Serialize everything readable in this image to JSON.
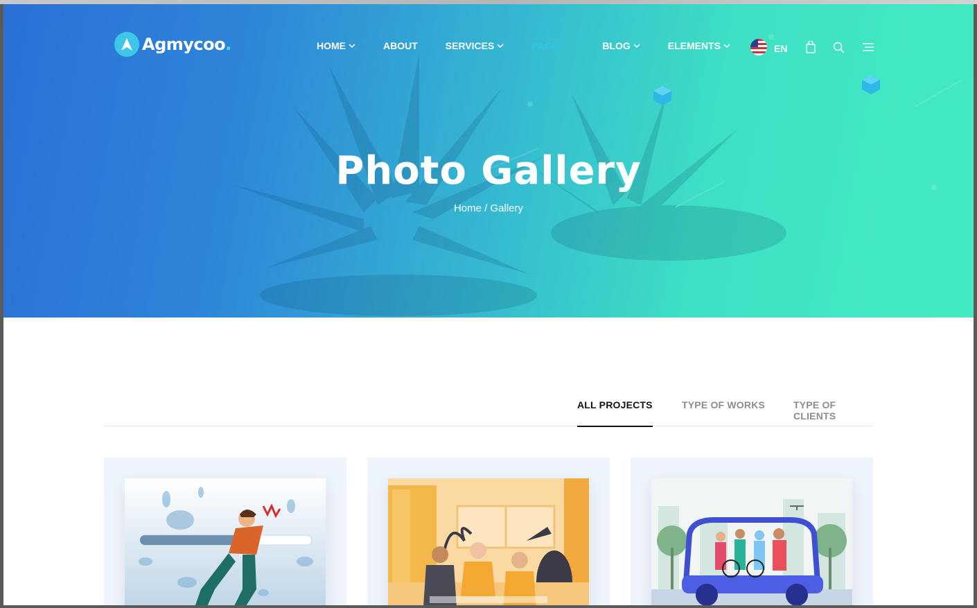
{
  "brand": {
    "name": "Agmycoo",
    "dot": "."
  },
  "nav": {
    "items": [
      {
        "label": "HOME",
        "dropdown": true
      },
      {
        "label": "ABOUT",
        "dropdown": false
      },
      {
        "label": "SERVICES",
        "dropdown": true
      },
      {
        "label": "PAGES",
        "dropdown": false
      },
      {
        "label": "BLOG",
        "dropdown": true
      },
      {
        "label": "ELEMENTS",
        "dropdown": true
      }
    ],
    "language": "EN",
    "icons": [
      "us-flag-icon",
      "shopping-bag-icon",
      "search-icon",
      "menu-icon"
    ]
  },
  "hero": {
    "title": "Photo Gallery",
    "breadcrumb": {
      "home": "Home",
      "separator": " / ",
      "current": "Gallery"
    }
  },
  "filters": {
    "tabs": [
      {
        "label": "ALL PROJECTS",
        "active": true
      },
      {
        "label": "TYPE OF WORKS",
        "active": false
      },
      {
        "label": "TYPE OF CLIENTS",
        "active": false
      }
    ]
  },
  "gallery": {
    "items": [
      {
        "illustration": "runner-progress-illustration"
      },
      {
        "illustration": "business-meeting-illustration"
      },
      {
        "illustration": "family-electric-car-illustration"
      }
    ]
  },
  "colors": {
    "hero_gradient_start": "#2a6fd6",
    "hero_gradient_end": "#44ebc2",
    "accent": "#3ec6e8",
    "active_tab": "#111111",
    "inactive_tab": "#8c8c8c",
    "card_bg": "#eef4fb"
  }
}
